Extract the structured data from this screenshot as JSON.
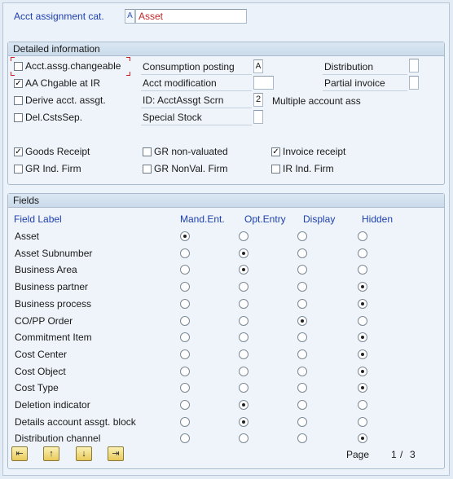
{
  "header": {
    "acct_cat_label": "Acct assignment cat.",
    "acct_cat_code": "A",
    "acct_cat_value": "Asset"
  },
  "detailed": {
    "title": "Detailed information",
    "col1": [
      {
        "label": "Acct.assg.changeable",
        "checked": false
      },
      {
        "label": "AA Chgable at IR",
        "checked": true
      },
      {
        "label": "Derive acct. assgt.",
        "checked": false
      },
      {
        "label": "Del.CstsSep.",
        "checked": false
      }
    ],
    "consumption_label": "Consumption posting",
    "consumption_value": "A",
    "acct_mod_label": "Acct modification",
    "acct_mod_value": "",
    "id_scrn_label": "ID: AcctAssgt Scrn",
    "id_scrn_value": "2",
    "id_scrn_text": "Multiple account ass",
    "special_stock_label": "Special Stock",
    "special_stock_value": "",
    "distribution_label": "Distribution",
    "partial_invoice_label": "Partial invoice",
    "row5": [
      {
        "label": "Goods Receipt",
        "checked": true
      },
      {
        "label": "GR non-valuated",
        "checked": false
      },
      {
        "label": "Invoice receipt",
        "checked": true
      }
    ],
    "row6": [
      {
        "label": "GR Ind. Firm",
        "checked": false
      },
      {
        "label": "GR NonVal. Firm",
        "checked": false
      },
      {
        "label": "IR Ind. Firm",
        "checked": false
      }
    ]
  },
  "fields": {
    "title": "Fields",
    "headers": [
      "Field Label",
      "Mand.Ent.",
      "Opt.Entry",
      "Display",
      "Hidden"
    ],
    "rows": [
      {
        "label": "Asset",
        "sel": 0
      },
      {
        "label": "Asset Subnumber",
        "sel": 1
      },
      {
        "label": "Business Area",
        "sel": 1
      },
      {
        "label": "Business partner",
        "sel": 3
      },
      {
        "label": "Business process",
        "sel": 3
      },
      {
        "label": "CO/PP Order",
        "sel": 2
      },
      {
        "label": "Commitment Item",
        "sel": 3
      },
      {
        "label": "Cost Center",
        "sel": 3
      },
      {
        "label": "Cost Object",
        "sel": 3
      },
      {
        "label": "Cost Type",
        "sel": 3
      },
      {
        "label": "Deletion indicator",
        "sel": 1
      },
      {
        "label": "Details account assgt. block",
        "sel": 1
      },
      {
        "label": "Distribution channel",
        "sel": 3
      }
    ]
  },
  "footer": {
    "page_label": "Page",
    "page_current": "1",
    "page_sep": "/",
    "page_total": "3",
    "nav_buttons": [
      {
        "name": "first-page-icon",
        "glyph": "⇤"
      },
      {
        "name": "previous-page-icon",
        "glyph": "↑"
      },
      {
        "name": "next-page-icon",
        "glyph": "↓"
      },
      {
        "name": "last-page-icon",
        "glyph": "⇥"
      }
    ]
  }
}
